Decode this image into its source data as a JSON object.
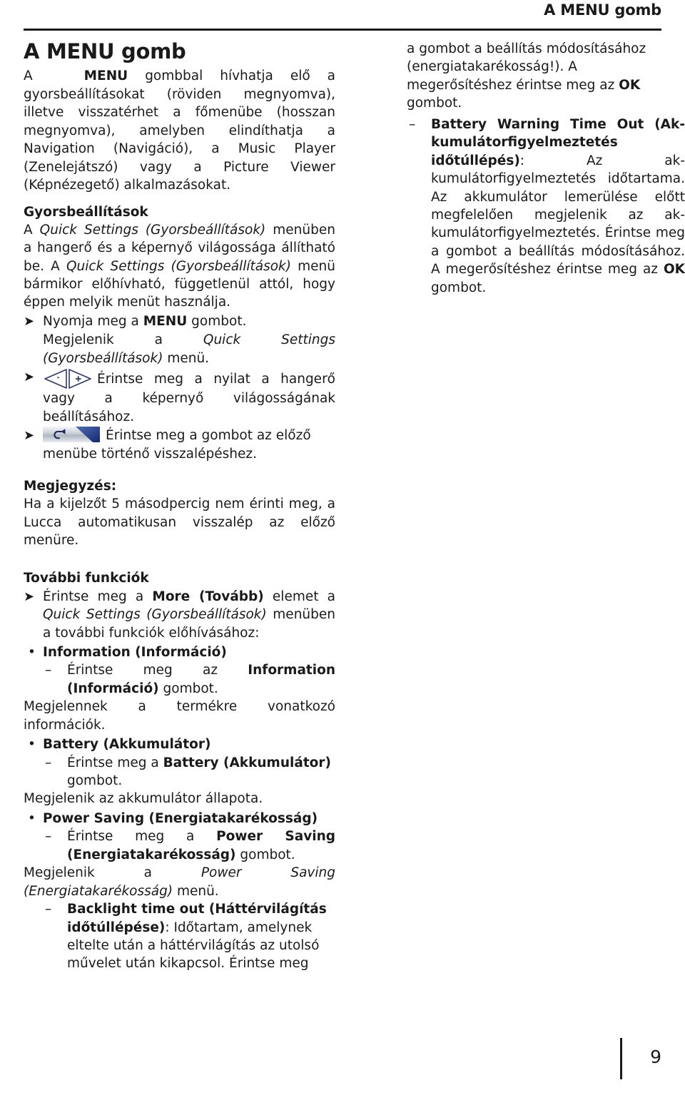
{
  "header": {
    "running_title": "A MENU gomb"
  },
  "footer": {
    "page_number": "9"
  },
  "icons": {
    "volume_arrows": "volume-arrows-icon",
    "back_button": "back-button-icon"
  },
  "left_column": {
    "doc_title": "A MENU gomb",
    "intro": {
      "lead_a": "A",
      "bold_menu": "MENU",
      "rest": " gombbal hívhatja elő a gyorsbeállításokat (röviden megnyomva), illetve visszatérhet a főmenübe (hosszan megnyomva), amelyben elindíthatja a Navigation (Navigáció), a Music Player (Zenelejátszó) vagy a Picture Viewer (Képnézegető) alkalmazásokat."
    },
    "quick_settings": {
      "heading": "Gyorsbeállítások",
      "p1_a": "A ",
      "p1_i1": "Quick Settings (Gyorsbeállítások)",
      "p1_b": " menüben a hangerő és a képernyő világossága állítható be. A ",
      "p1_i2": "Quick Settings (Gyorsbeállítások)",
      "p1_c": " menü bármikor előhívható, függetlenül attól, hogy éppen melyik menüt használja.",
      "step1_a": "Nyomja meg a ",
      "step1_bold": "MENU",
      "step1_b": " gombot.",
      "step1_result_a": "Megjelenik a ",
      "step1_result_i": "Quick Settings (Gyorsbeállítások)",
      "step1_result_b": " menü.",
      "step2": "Érintse meg a nyilat a hangerő vagy a képernyő világosságának beállításához.",
      "step3": "Érintse meg a gombot az előző menübe történő visszalépéshez."
    },
    "note": {
      "heading": "Megjegyzés:",
      "body": "Ha a kijelzőt 5 másodpercig nem érinti meg, a Lucca automatikusan visszalép az előző menüre."
    },
    "more_functions": {
      "heading": "További funkciók",
      "step_a": "Érintse meg a ",
      "step_bold": "More (Tovább)",
      "step_b": " elemet a ",
      "step_i": "Quick Settings (Gyorsbeállítások)",
      "step_c": " menüben a további funkciók előhívásához:",
      "items": [
        {
          "title": "Information (Információ)",
          "sub_a": "Érintse meg az ",
          "sub_bold": "Information (Információ)",
          "sub_b": " gombot.",
          "result": "Megjelennek a termékre vonatkozó információk."
        },
        {
          "title": "Battery (Akkumulátor)",
          "sub_a": "Érintse meg a ",
          "sub_bold": "Battery (Akkumulátor)",
          "sub_b": " gombot.",
          "result": "Megjelenik az akkumulátor állapota."
        },
        {
          "title": "Power Saving (Energiatakarékosság)",
          "sub_a": "Érintse meg a ",
          "sub_bold": "Power Saving (Energiatakarékosság)",
          "sub_b": " gombot.",
          "result_a": "Megjelenik a ",
          "result_i": "Power Saving (Energiatakarékosság)",
          "result_b": " menü."
        }
      ],
      "backlight": {
        "bold": "Backlight time out (Háttérvilágítás időtúllépése)",
        "rest": ": Időtartam, amelynek eltelte után a háttérvilágítás az utolsó művelet után kikapcsol. Érintse meg"
      }
    }
  },
  "right_column": {
    "backlight_cont_a": "a gombot a beállítás módosításához (energiatakarékosság!). A megerősítéshez érintse meg az ",
    "backlight_cont_bold": "OK",
    "backlight_cont_b": " gombot.",
    "battery_warning": {
      "bold": "Battery Warning Time Out (Ak­kumulátorfigyelmeztetés időtúllépés)",
      "rest_a": ": Az ak­kumulátorfigyelmeztetés időtartama. Az ak­kumulátor lemerülése előtt megfelelően megjelenik az ak­kumulátorfigyelmeztetés. Érintse meg a gombot a beállítás módosításához. A megerősítéshez érintse meg az ",
      "rest_bold": "OK",
      "rest_b": " gombot."
    }
  }
}
